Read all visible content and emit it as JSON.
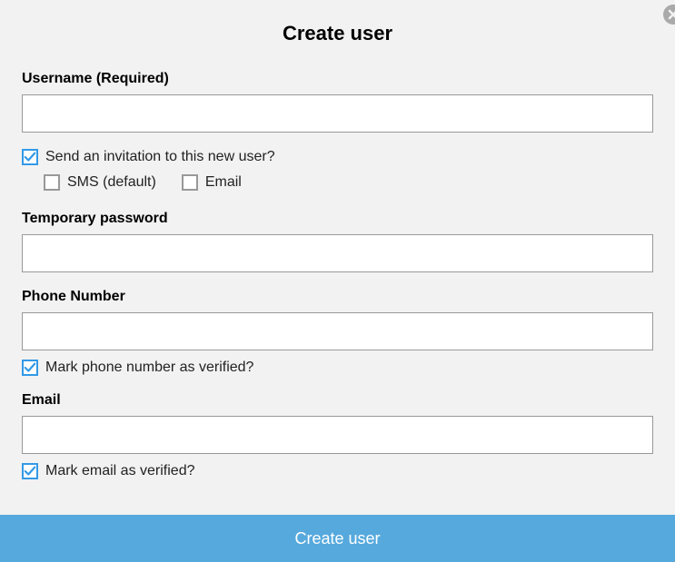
{
  "title": "Create user",
  "fields": {
    "username": {
      "label": "Username (Required)",
      "value": ""
    },
    "tempPassword": {
      "label": "Temporary password",
      "value": ""
    },
    "phone": {
      "label": "Phone Number",
      "value": ""
    },
    "email": {
      "label": "Email",
      "value": ""
    }
  },
  "invitation": {
    "sendLabel": "Send an invitation to this new user?",
    "sendChecked": true,
    "smsLabel": "SMS (default)",
    "smsChecked": false,
    "emailLabel": "Email",
    "emailChecked": false
  },
  "verify": {
    "phoneLabel": "Mark phone number as verified?",
    "phoneChecked": true,
    "emailLabel": "Mark email as verified?",
    "emailChecked": true
  },
  "submitLabel": "Create user"
}
